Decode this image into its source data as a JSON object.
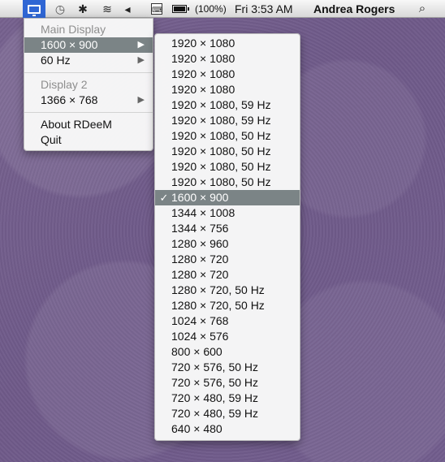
{
  "menubar": {
    "icons": {
      "app": "display-icon",
      "clock": "clock-icon",
      "bluetooth": "bluetooth-icon",
      "wifi": "wifi-icon",
      "volume": "volume-icon",
      "keyboard": "keyboard-icon",
      "battery": "battery-icon",
      "spotlight": "search-icon"
    },
    "battery_percent_text": "(100%)",
    "battery_level": 100,
    "time": "Fri 3:53 AM",
    "user": "Andrea Rogers"
  },
  "main_menu": {
    "section_main_display": "Main Display",
    "resolution_item": "1600 × 900",
    "refresh_item": "60 Hz",
    "section_display_2": "Display 2",
    "display_2_resolution": "1366 × 768",
    "about": "About RDeeM",
    "quit": "Quit"
  },
  "submenu": {
    "items": [
      "1920 × 1080",
      "1920 × 1080",
      "1920 × 1080",
      "1920 × 1080",
      "1920 × 1080, 59 Hz",
      "1920 × 1080, 59 Hz",
      "1920 × 1080, 50 Hz",
      "1920 × 1080, 50 Hz",
      "1920 × 1080, 50 Hz",
      "1920 × 1080, 50 Hz",
      "1600 × 900",
      "1344 × 1008",
      "1344 × 756",
      "1280 × 960",
      "1280 × 720",
      "1280 × 720",
      "1280 × 720, 50 Hz",
      "1280 × 720, 50 Hz",
      "1024 × 768",
      "1024 × 576",
      "800 × 600",
      "720 × 576, 50 Hz",
      "720 × 576, 50 Hz",
      "720 × 480, 59 Hz",
      "720 × 480, 59 Hz",
      "640 × 480"
    ],
    "checkmark": "✓"
  },
  "colors": {
    "desktop": "#725d8d",
    "menubar_top": "#f8f8f8",
    "menubar_bottom": "#d8d8d8",
    "highlight": "#7b8486",
    "app_icon_bg": "#2f66d4"
  }
}
